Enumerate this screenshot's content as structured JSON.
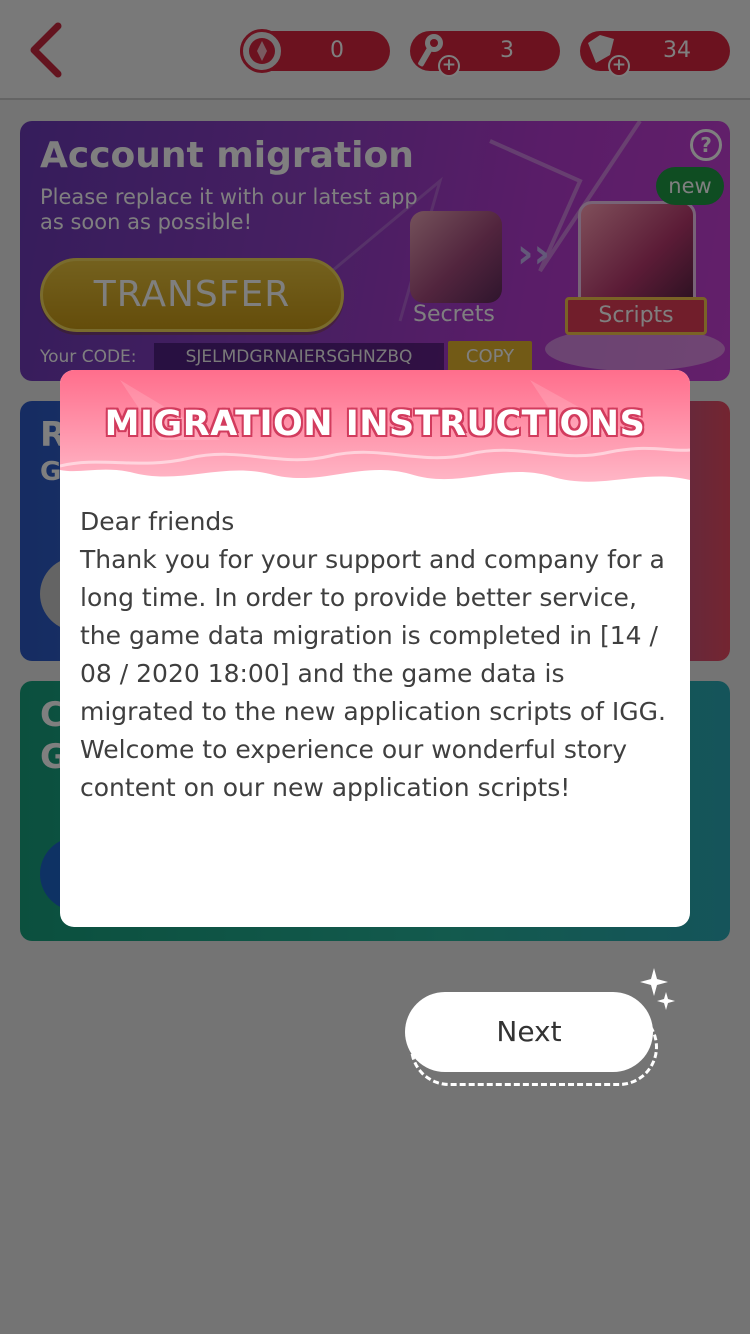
{
  "header": {
    "currencies": [
      {
        "icon": "leaf-badge-icon",
        "value": "0",
        "has_plus": false
      },
      {
        "icon": "key-icon",
        "value": "3",
        "has_plus": true
      },
      {
        "icon": "diamond-icon",
        "value": "34",
        "has_plus": true
      }
    ],
    "plus_symbol": "+"
  },
  "banner": {
    "title": "Account migration",
    "subtitle": "Please replace it with our latest app as soon as possible!",
    "transfer_label": "TRANSFER",
    "code_label": "Your CODE:",
    "code_value": "SJELMDGRNAIERSGHNZBQ",
    "copy_label": "COPY",
    "old_app_label": "Secrets",
    "new_app_label": "Scripts",
    "new_badge": "new",
    "help_symbol": "?"
  },
  "background_cards": {
    "blue_letters": [
      "R",
      "G"
    ],
    "green_letters": [
      "C",
      "G"
    ]
  },
  "dialog": {
    "title": "MIGRATION INSTRUCTIONS",
    "greeting": "Dear friends",
    "message": "Thank you for your support and company for a long time. In order to provide better service, the game data migration is completed in [14 / 08 / 2020 18:00] and the game data is migrated to the new application scripts of IGG. Welcome to experience our wonderful story content on our new application scripts!"
  },
  "next_button": {
    "label": "Next"
  },
  "colors": {
    "accent_red": "#d8243f",
    "dialog_header_pink": "#ff6f8f",
    "overlay": "rgba(0,0,0,0.5)"
  }
}
